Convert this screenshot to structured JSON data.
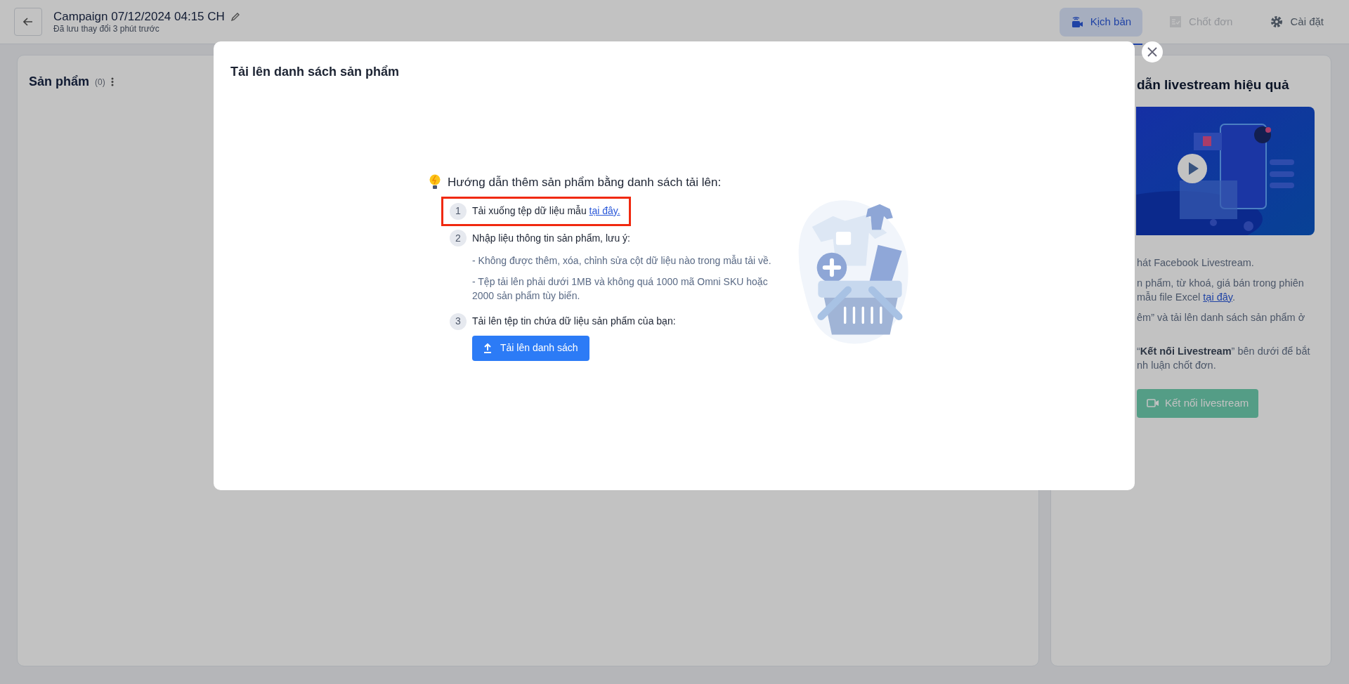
{
  "header": {
    "title": "Campaign 07/12/2024 04:15 CH",
    "subtitle": "Đã lưu thay đổi 3 phút trước",
    "tabs": [
      {
        "label": "Kịch bản",
        "selected": true,
        "disabled": false
      },
      {
        "label": "Chốt đơn",
        "selected": false,
        "disabled": true
      },
      {
        "label": "Cài đặt",
        "selected": false,
        "disabled": false
      }
    ]
  },
  "products_panel": {
    "title": "Sản phẩm",
    "count": "(0)"
  },
  "guide_panel": {
    "title": "dẫn livestream hiệu quả",
    "paragraphs": [
      {
        "lines": [
          {
            "text": "hát Facebook Livestream."
          }
        ]
      },
      {
        "lines": [
          {
            "text": "n phẩm, từ khoá, giá bán trong phiên"
          },
          {
            "text": "mẫu file Excel ",
            "link": "tại đây",
            "tail": "."
          }
        ]
      },
      {
        "lines": [
          {
            "text": "êm” và tải lên danh sách sản phẩm ở"
          }
        ]
      },
      {
        "lines": [
          {
            "text": "“**Kết nối Livestream**” bên dưới để bắt"
          },
          {
            "text": "nh luận chốt đơn."
          }
        ]
      }
    ],
    "button": {
      "label": "Kết nối livestream",
      "disabled": true
    }
  },
  "modal": {
    "title": "Tải lên danh sách sản phẩm",
    "heading": "Hướng dẫn thêm sản phẩm bằng danh sách tải lên:",
    "steps": [
      {
        "number": "1",
        "text": "Tải xuống tệp dữ liệu mẫu ",
        "link": "tại đây.",
        "highlighted": true
      },
      {
        "number": "2",
        "text": "Nhập liệu thông tin sản phẩm, lưu ý:",
        "highlighted": false,
        "notes": [
          "- Không được thêm, xóa, chỉnh sửa cột dữ liệu nào trong mẫu tải về.",
          "- Tệp tải lên phải dưới 1MB và không quá 1000 mã Omni SKU hoặc 2000 sản phẩm tùy biến."
        ]
      },
      {
        "number": "3",
        "text": "Tải lên tệp tin chứa dữ liệu sản phẩm của bạn:",
        "highlighted": false
      }
    ],
    "upload_button": "Tải lên danh sách"
  }
}
